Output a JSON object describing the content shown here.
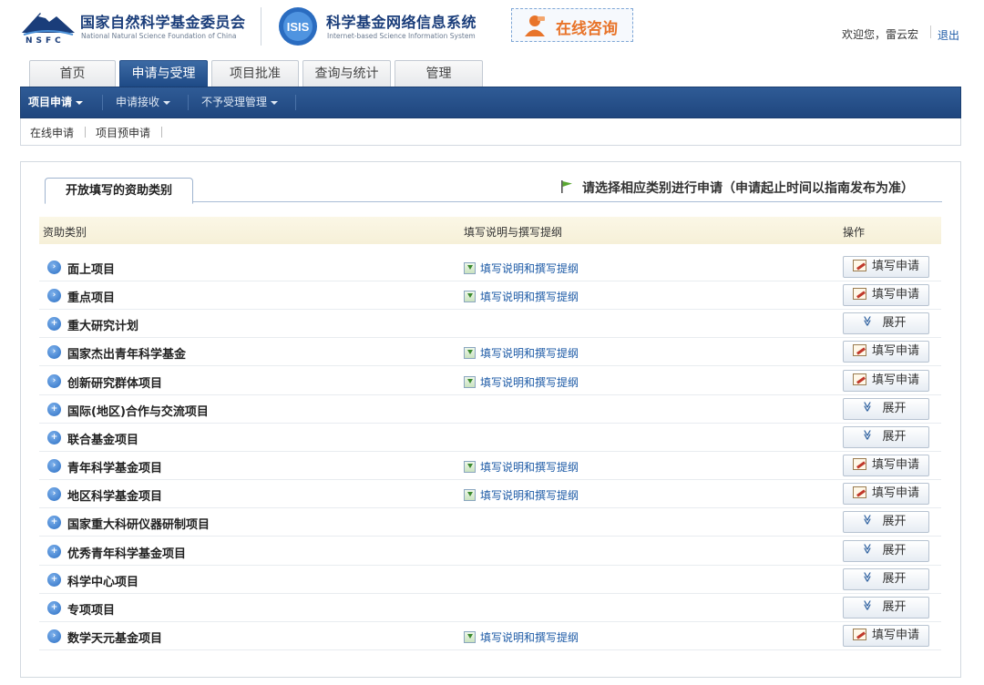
{
  "header": {
    "nsfc_name": "国家自然科学基金委员会",
    "nsfc_english": "National Natural Science Foundation of China",
    "nsfc_abbr": "NSFC",
    "isis_badge": "ISIS",
    "system_name": "科学基金网络信息系统",
    "system_english": "Internet-based Science Information System",
    "consult_label": "在线咨询",
    "welcome": "欢迎您，雷云宏",
    "logout": "退出"
  },
  "tabs": [
    {
      "label": "首页",
      "active": false
    },
    {
      "label": "申请与受理",
      "active": true
    },
    {
      "label": "项目批准",
      "active": false
    },
    {
      "label": "查询与统计",
      "active": false
    },
    {
      "label": "管理",
      "active": false
    }
  ],
  "navbar": [
    {
      "label": "项目申请",
      "active": true
    },
    {
      "label": "申请接收",
      "active": false
    },
    {
      "label": "不予受理管理",
      "active": false
    }
  ],
  "subnav": [
    "在线申请",
    "项目预申请"
  ],
  "panel": {
    "tab_label": "开放填写的资助类别",
    "notice": "请选择相应类别进行申请（申请起止时间以指南发布为准）",
    "columns": [
      "资助类别",
      "填写说明与撰写提纲",
      "操作"
    ]
  },
  "labels": {
    "guide": "填写说明和撰写提纲",
    "fill": "填写申请",
    "expand": "展开"
  },
  "rows": [
    {
      "name": "面上项目",
      "type": "fill",
      "icon": "arrow-right-icon"
    },
    {
      "name": "重点项目",
      "type": "fill",
      "icon": "arrow-right-icon"
    },
    {
      "name": "重大研究计划",
      "type": "expand",
      "icon": "plus-icon"
    },
    {
      "name": "国家杰出青年科学基金",
      "type": "fill",
      "icon": "arrow-right-icon"
    },
    {
      "name": "创新研究群体项目",
      "type": "fill",
      "icon": "arrow-right-icon"
    },
    {
      "name": "国际(地区)合作与交流项目",
      "type": "expand",
      "icon": "plus-icon"
    },
    {
      "name": "联合基金项目",
      "type": "expand",
      "icon": "plus-icon"
    },
    {
      "name": "青年科学基金项目",
      "type": "fill",
      "icon": "arrow-right-icon"
    },
    {
      "name": "地区科学基金项目",
      "type": "fill",
      "icon": "arrow-right-icon"
    },
    {
      "name": "国家重大科研仪器研制项目",
      "type": "expand",
      "icon": "plus-icon"
    },
    {
      "name": "优秀青年科学基金项目",
      "type": "expand",
      "icon": "plus-icon"
    },
    {
      "name": "科学中心项目",
      "type": "expand",
      "icon": "plus-icon"
    },
    {
      "name": "专项项目",
      "type": "expand",
      "icon": "plus-icon"
    },
    {
      "name": "数学天元基金项目",
      "type": "fill",
      "icon": "arrow-right-icon"
    }
  ],
  "colors": {
    "brand_blue": "#1e4a86",
    "link_blue": "#1c5aa6",
    "consult_orange": "#e8742a"
  }
}
